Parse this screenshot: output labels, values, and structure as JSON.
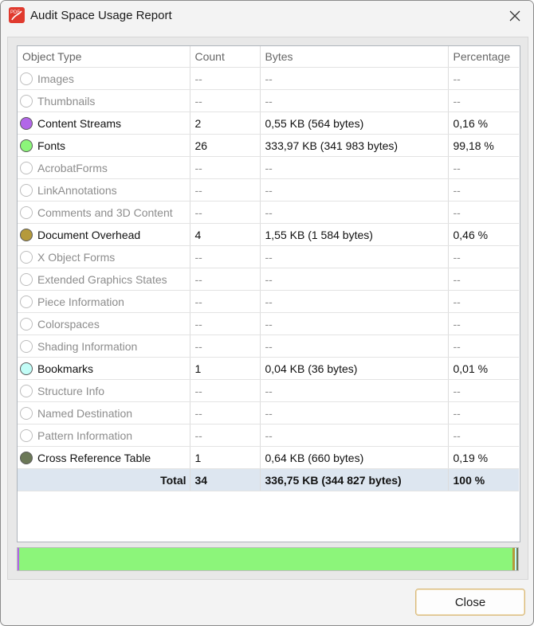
{
  "window": {
    "title": "Audit Space Usage Report",
    "icon": "pdf-app-icon",
    "close_icon": "close-icon"
  },
  "table": {
    "columns": [
      "Object Type",
      "Count",
      "Bytes",
      "Percentage"
    ],
    "rows": [
      {
        "type": "Images",
        "count": "--",
        "bytes": "--",
        "percentage": "--",
        "color": null
      },
      {
        "type": "Thumbnails",
        "count": "--",
        "bytes": "--",
        "percentage": "--",
        "color": null
      },
      {
        "type": "Content Streams",
        "count": "2",
        "bytes": "0,55 KB (564 bytes)",
        "percentage": "0,16 %",
        "color": "#b266e8"
      },
      {
        "type": "Fonts",
        "count": "26",
        "bytes": "333,97 KB (341 983 bytes)",
        "percentage": "99,18 %",
        "color": "#8cf57a"
      },
      {
        "type": "AcrobatForms",
        "count": "--",
        "bytes": "--",
        "percentage": "--",
        "color": null
      },
      {
        "type": "LinkAnnotations",
        "count": "--",
        "bytes": "--",
        "percentage": "--",
        "color": null
      },
      {
        "type": "Comments and 3D Content",
        "count": "--",
        "bytes": "--",
        "percentage": "--",
        "color": null
      },
      {
        "type": "Document Overhead",
        "count": "4",
        "bytes": "1,55 KB (1 584 bytes)",
        "percentage": "0,46 %",
        "color": "#b59a3c"
      },
      {
        "type": "X Object Forms",
        "count": "--",
        "bytes": "--",
        "percentage": "--",
        "color": null
      },
      {
        "type": "Extended Graphics States",
        "count": "--",
        "bytes": "--",
        "percentage": "--",
        "color": null
      },
      {
        "type": "Piece Information",
        "count": "--",
        "bytes": "--",
        "percentage": "--",
        "color": null
      },
      {
        "type": "Colorspaces",
        "count": "--",
        "bytes": "--",
        "percentage": "--",
        "color": null
      },
      {
        "type": "Shading Information",
        "count": "--",
        "bytes": "--",
        "percentage": "--",
        "color": null
      },
      {
        "type": "Bookmarks",
        "count": "1",
        "bytes": "0,04 KB (36 bytes)",
        "percentage": "0,01 %",
        "color": "#c2fdf7"
      },
      {
        "type": "Structure Info",
        "count": "--",
        "bytes": "--",
        "percentage": "--",
        "color": null
      },
      {
        "type": "Named Destination",
        "count": "--",
        "bytes": "--",
        "percentage": "--",
        "color": null
      },
      {
        "type": "Pattern Information",
        "count": "--",
        "bytes": "--",
        "percentage": "--",
        "color": null
      },
      {
        "type": "Cross Reference Table",
        "count": "1",
        "bytes": "0,64 KB (660 bytes)",
        "percentage": "0,19 %",
        "color": "#6b7857"
      }
    ],
    "total": {
      "label": "Total",
      "count": "34",
      "bytes": "336,75 KB (344 827 bytes)",
      "percentage": "100 %"
    }
  },
  "usage_bar": {
    "segments": [
      {
        "name": "Content Streams",
        "fraction": 0.0016,
        "color": "#b266e8"
      },
      {
        "name": "Fonts",
        "fraction": 0.9918,
        "color": "#8cf57a"
      },
      {
        "name": "Document Overhead",
        "fraction": 0.0046,
        "color": "#b59a3c"
      },
      {
        "name": "Bookmarks",
        "fraction": 0.0001,
        "color": "#c2fdf7"
      },
      {
        "name": "Cross Reference Table",
        "fraction": 0.0019,
        "color": "#6b7857"
      }
    ]
  },
  "footer": {
    "close_label": "Close"
  }
}
